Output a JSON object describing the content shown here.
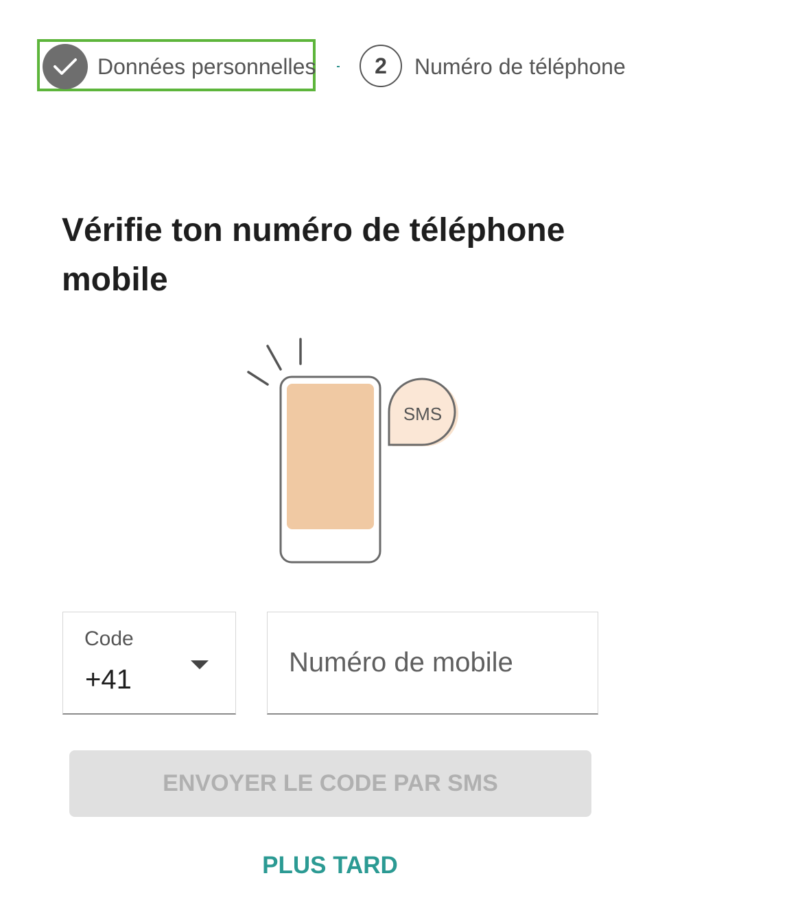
{
  "stepper": {
    "step1": {
      "label": "Données personnelles",
      "status": "completed",
      "icon": "check-icon"
    },
    "step2": {
      "number": "2",
      "label": "Numéro de téléphone",
      "status": "current"
    },
    "highlight_color": "#5db53b"
  },
  "page": {
    "title": "Vérifie ton numéro de téléphone mobile"
  },
  "illustration": {
    "icon": "phone-sms-illustration",
    "bubble_text": "SMS",
    "screen_color": "#f0c9a3"
  },
  "form": {
    "code": {
      "label": "Code",
      "value": "+41",
      "icon": "caret-down-icon"
    },
    "mobile": {
      "placeholder": "Numéro de mobile",
      "value": ""
    }
  },
  "actions": {
    "send_label": "ENVOYER LE CODE PAR SMS",
    "send_disabled": true,
    "later_label": "PLUS TARD",
    "accent_color": "#2b9a93"
  }
}
